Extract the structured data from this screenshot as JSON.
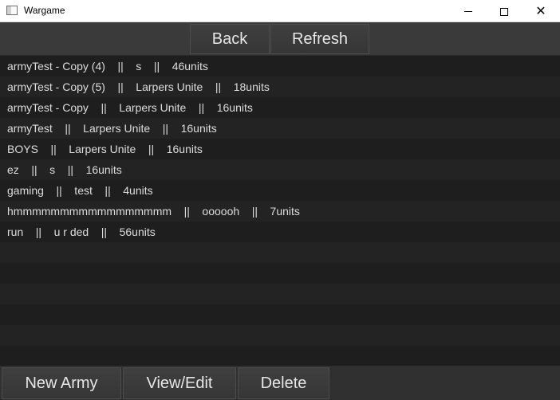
{
  "window": {
    "title": "Wargame",
    "icon": "app-window-icon",
    "controls": [
      "minimize-icon",
      "maximize-icon",
      "close-icon"
    ],
    "close_glyph": "✕"
  },
  "toolbar": {
    "back_label": "Back",
    "refresh_label": "Refresh"
  },
  "armies": [
    "armyTest - Copy (4)    ||    s    ||    46units",
    "armyTest - Copy (5)    ||    Larpers Unite    ||    18units",
    "armyTest - Copy    ||    Larpers Unite    ||    16units",
    "armyTest    ||    Larpers Unite    ||    16units",
    "BOYS    ||    Larpers Unite    ||    16units",
    "ez    ||    s    ||    16units",
    "gaming    ||    test    ||    4units",
    "hmmmmmmmmmmmmmmmmm    ||    oooooh    ||    7units",
    "run    ||    u r ded    ||    56units",
    "",
    "",
    "",
    "",
    "",
    ""
  ],
  "actions": {
    "new_label": "New Army",
    "view_label": "View/Edit",
    "delete_label": "Delete"
  },
  "colors": {
    "list_background": "#1c1c1c",
    "button_background": "#3a3a3a",
    "text": "#dcdcdc"
  }
}
